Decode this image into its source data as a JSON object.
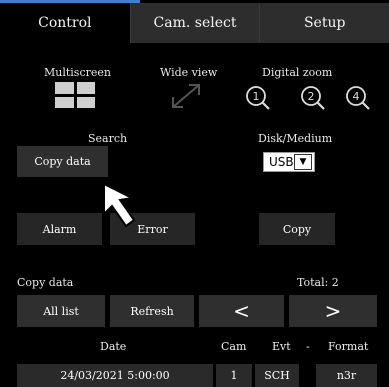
{
  "tabs": [
    {
      "label": "Control",
      "active": true
    },
    {
      "label": "Cam. select",
      "active": false
    },
    {
      "label": "Setup",
      "active": false
    }
  ],
  "labels": {
    "multiscreen": "Multiscreen",
    "wide_view": "Wide view",
    "digital_zoom": "Digital zoom",
    "search": "Search",
    "disk_medium": "Disk/Medium",
    "copy_data_section": "Copy data",
    "total": "Total: 2"
  },
  "zoom_levels": [
    "1",
    "2",
    "4"
  ],
  "buttons": {
    "copy_data": "Copy data",
    "alarm": "Alarm",
    "error": "Error",
    "copy": "Copy",
    "all_list": "All list",
    "refresh": "Refresh",
    "prev": "<",
    "next": ">"
  },
  "disk_select": {
    "value": "USB"
  },
  "table": {
    "headers": {
      "date": "Date",
      "cam": "Cam",
      "evt": "Evt",
      "dash": "-",
      "format": "Format"
    },
    "rows": [
      {
        "date": "24/03/2021  5:00:00",
        "cam": "1",
        "evt": "SCH",
        "format": "n3r"
      }
    ]
  },
  "colors": {
    "accent": "#3f7fd0",
    "panel": "#2d2d2d",
    "button": "#2f2f2f"
  }
}
